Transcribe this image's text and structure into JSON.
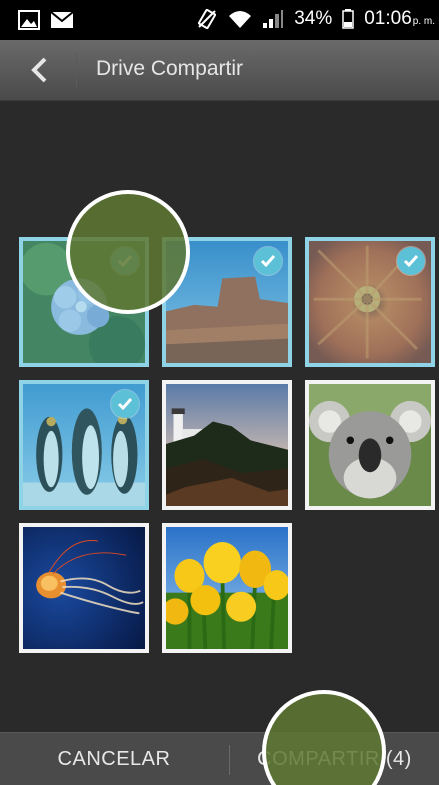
{
  "status_bar": {
    "battery": "34%",
    "time": "01:06",
    "ampm": "p. m.",
    "icons": [
      "picture-icon",
      "mail-icon",
      "vibrate-icon",
      "wifi-icon",
      "signal-icon",
      "battery-icon"
    ]
  },
  "action_bar": {
    "title": "Drive Compartir",
    "back_icon": "back-arrow-icon"
  },
  "photos": [
    {
      "name": "hydrangeas",
      "selected": true
    },
    {
      "name": "desert",
      "selected": true
    },
    {
      "name": "chrysanthemum",
      "selected": true
    },
    {
      "name": "penguins",
      "selected": true
    },
    {
      "name": "lighthouse",
      "selected": false
    },
    {
      "name": "koala",
      "selected": false
    },
    {
      "name": "jellyfish",
      "selected": false
    },
    {
      "name": "tulips",
      "selected": false
    }
  ],
  "bottom_bar": {
    "cancel_label": "CANCELAR",
    "share_label": "COMPARTIR (4)"
  },
  "colors": {
    "selection_border": "#8fd3e6",
    "check_badge": "#5cc0d6",
    "touch_marker": "#5f7832"
  }
}
